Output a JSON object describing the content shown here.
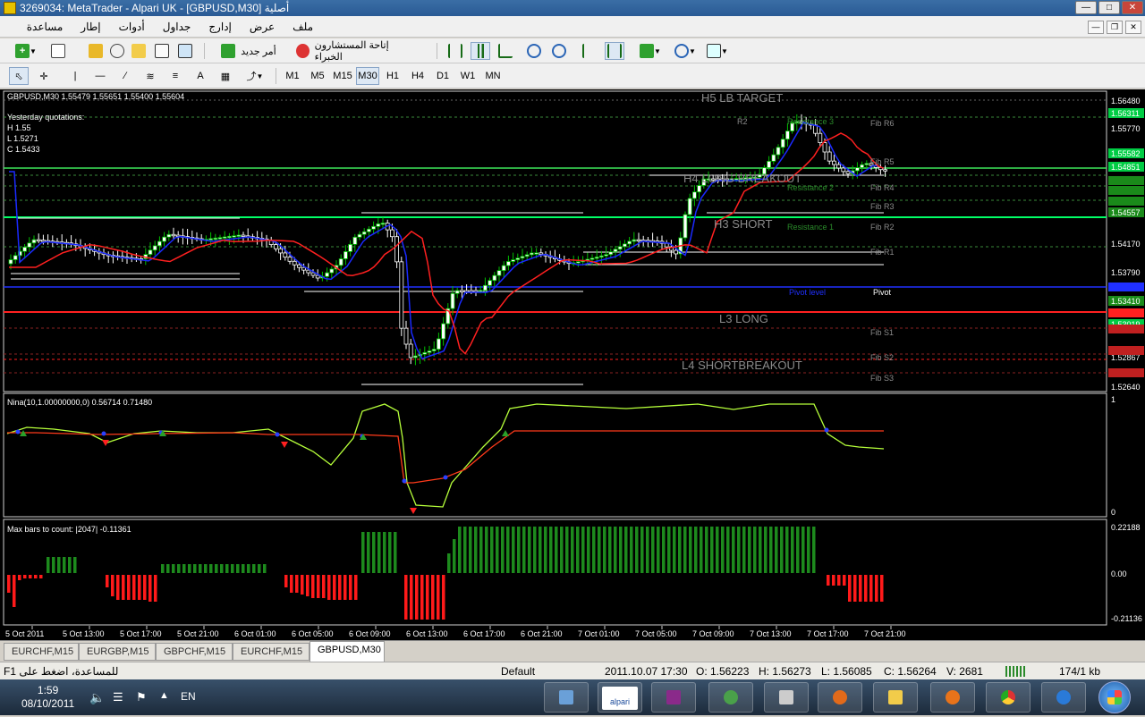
{
  "window": {
    "title": "3269034: MetaTrader - Alpari UK - [GBPUSD,M30] أصلية"
  },
  "menu": {
    "items": [
      "ملف",
      "عرض",
      "إدارج",
      "جداول",
      "أدوات",
      "إطار",
      "مساعدة"
    ]
  },
  "toolbar1": {
    "new_order_label": "أمر جديد",
    "experts_label": "إتاحة المستشارون الخبراء"
  },
  "timeframes": [
    "M1",
    "M5",
    "M15",
    "M30",
    "H1",
    "H4",
    "D1",
    "W1",
    "MN"
  ],
  "active_timeframe": "M30",
  "chart": {
    "symbol_info": "GBPUSD,M30  1.55479 1.55651 1.55400 1.55604",
    "yesterday_title": "Yesterday quotations:",
    "yesterday_h": "H 1.55",
    "yesterday_l": "L 1.5271",
    "yesterday_c": "C 1.5433",
    "labels": {
      "h5": "H5 LB TARGET",
      "h4": "H4 LONG BREAKOUT",
      "h3": "H3 SHORT",
      "l3": "L3 LONG",
      "l4": "L4 SHORTBREAKOUT",
      "r2": "R2",
      "res3": "Resistance 3",
      "res2": "Resistance 2",
      "res1": "Resistance 1",
      "pivot_level": "Pivot level",
      "pivot": "Pivot",
      "fib_r6": "Fib R6",
      "fib_r5": "Fib R5",
      "fib_r4": "Fib R4",
      "fib_r3": "Fib R3",
      "fib_r2": "Fib R2",
      "fib_r1": "Fib R1",
      "fib_s1": "Fib S1",
      "fib_s2": "Fib S2",
      "fib_s3": "Fib S3"
    },
    "price_scale": [
      "1.56480",
      "1.56311",
      "1.55770",
      "1.55582",
      "1.54851",
      "1.54557",
      "1.54170",
      "1.53790",
      "1.53410",
      "1.53019",
      "1.52867",
      "1.52640"
    ],
    "indicator1": {
      "label": "Nina(10,1.00000000,0) 0.56714 0.71480",
      "scale_top": "1",
      "scale_bottom": "0"
    },
    "indicator2": {
      "label": "Max bars to count: |2047|  -0.11361",
      "scale_top": "0.22188",
      "scale_mid": "0.00",
      "scale_bottom": "-0.21136"
    },
    "time_axis": [
      "5 Oct 2011",
      "5 Oct 13:00",
      "5 Oct 17:00",
      "5 Oct 21:00",
      "6 Oct 01:00",
      "6 Oct 05:00",
      "6 Oct 09:00",
      "6 Oct 13:00",
      "6 Oct 17:00",
      "6 Oct 21:00",
      "7 Oct 01:00",
      "7 Oct 05:00",
      "7 Oct 09:00",
      "7 Oct 13:00",
      "7 Oct 17:00",
      "7 Oct 21:00"
    ]
  },
  "tabs": [
    "EURCHF,M15",
    "EURGBP,M15",
    "GBPCHF,M15",
    "EURCHF,M15",
    "GBPUSD,M30"
  ],
  "active_tab": "GBPUSD,M30",
  "status": {
    "help": "F1 للمساعدة، اضغط على",
    "profile": "Default",
    "datetime": "2011.10.07 17:30",
    "open": "O: 1.56223",
    "high": "H: 1.56273",
    "low": "L: 1.56085",
    "close": "C: 1.56264",
    "volume": "V: 2681",
    "traffic": "174/1 kb"
  },
  "taskbar": {
    "time": "1:59",
    "date": "08/10/2011",
    "lang": "EN",
    "alpari_label": "alpari"
  },
  "colors": {
    "bull": "#00c000",
    "bear": "#ff2020",
    "green_line": "#00ff66",
    "blue": "#1a2aff",
    "red": "#ff2020",
    "grey": "#8a8a8a"
  }
}
